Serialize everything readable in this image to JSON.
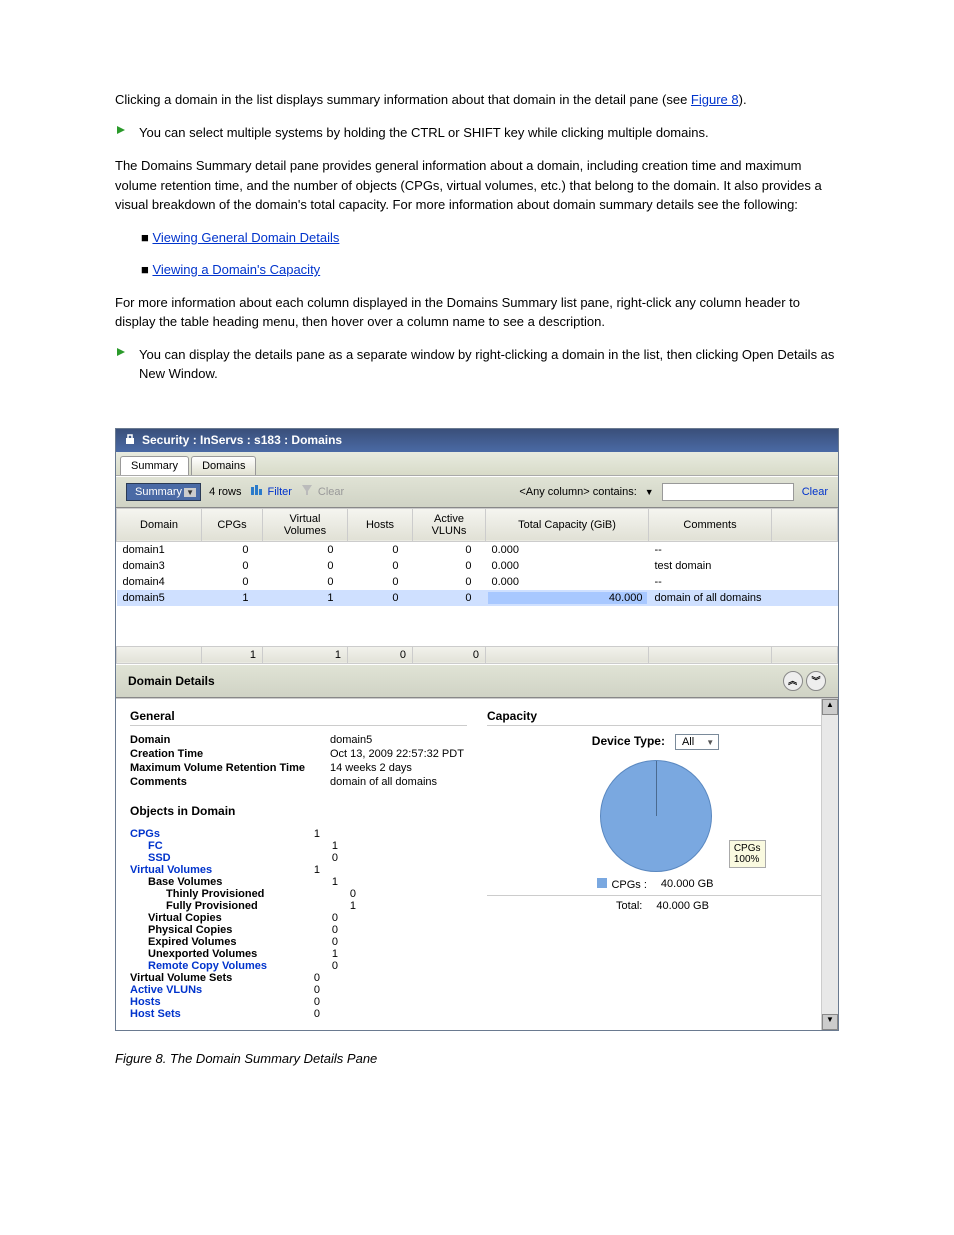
{
  "doc": {
    "text1": "Clicking a domain in the list displays summary information about that domain in the detail pane (see ",
    "link1": "Figure 8",
    "text1b": ").",
    "tip1": "You can select multiple systems by holding the CTRL or SHIFT key while clicking multiple domains.",
    "text2": "The Domains Summary detail pane provides general information about a domain, including creation time and maximum volume retention time, and the number of objects (CPGs, virtual volumes, etc.) that belong to the domain. It also provides a visual breakdown of the domain's total capacity. For more information about domain summary details see the following:",
    "bullet1": "Viewing General Domain Details",
    "bullet2": "Viewing a Domain's Capacity",
    "text3": "For more information about each column displayed in the Domains Summary list pane, right-click any column header to display the table heading menu, then hover over a column name to see a description.",
    "tip2": "You can display the details pane as a separate window by right-clicking a domain in the list, then clicking Open Details as New Window.",
    "figure": "Figure 8. The Domain Summary Details Pane"
  },
  "window": {
    "title": "Security : InServs : s183 : Domains",
    "tabs": {
      "summary": "Summary",
      "domains": "Domains"
    },
    "toolbar": {
      "summary": "Summary",
      "rows": "4 rows",
      "filter": "Filter",
      "clear_filter": "Clear",
      "search_label": "<Any column> contains:",
      "clear": "Clear"
    },
    "columns": [
      "Domain",
      "CPGs",
      "Virtual Volumes",
      "Hosts",
      "Active VLUNs",
      "Total Capacity (GiB)",
      "Comments"
    ],
    "rows": [
      {
        "domain": "domain1",
        "cpgs": 0,
        "vv": 0,
        "hosts": 0,
        "vluns": 0,
        "cap": "0.000",
        "comments": "--"
      },
      {
        "domain": "domain3",
        "cpgs": 0,
        "vv": 0,
        "hosts": 0,
        "vluns": 0,
        "cap": "0.000",
        "comments": "test domain"
      },
      {
        "domain": "domain4",
        "cpgs": 0,
        "vv": 0,
        "hosts": 0,
        "vluns": 0,
        "cap": "0.000",
        "comments": "--"
      },
      {
        "domain": "domain5",
        "cpgs": 1,
        "vv": 1,
        "hosts": 0,
        "vluns": 0,
        "cap": "40.000",
        "comments": "domain of all domains",
        "selected": true
      }
    ],
    "totals": {
      "cpgs": 1,
      "vv": 1,
      "hosts": 0,
      "vluns": 0
    }
  },
  "details": {
    "header": "Domain Details",
    "general": "General",
    "kv": {
      "domain_k": "Domain",
      "domain_v": "domain5",
      "ctime_k": "Creation Time",
      "ctime_v": "Oct 13, 2009 22:57:32 PDT",
      "ret_k": "Maximum Volume Retention Time",
      "ret_v": "14 weeks 2 days",
      "com_k": "Comments",
      "com_v": "domain of all domains"
    },
    "objects_title": "Objects in Domain",
    "objects": [
      {
        "label": "CPGs",
        "val": 1,
        "cls": "",
        "link": true
      },
      {
        "label": "FC",
        "val": 1,
        "cls": "sub1",
        "link": true
      },
      {
        "label": "SSD",
        "val": 0,
        "cls": "sub1",
        "link": true
      },
      {
        "label": "Virtual Volumes",
        "val": 1,
        "cls": "",
        "link": true
      },
      {
        "label": "Base Volumes",
        "val": 1,
        "cls": "sub1",
        "link": false,
        "bold": true
      },
      {
        "label": "Thinly Provisioned",
        "val": 0,
        "cls": "sub2",
        "link": false,
        "bold": true
      },
      {
        "label": "Fully Provisioned",
        "val": 1,
        "cls": "sub2",
        "link": false,
        "bold": true
      },
      {
        "label": "Virtual Copies",
        "val": 0,
        "cls": "sub1",
        "link": false,
        "bold": true
      },
      {
        "label": "Physical Copies",
        "val": 0,
        "cls": "sub1",
        "link": false,
        "bold": true
      },
      {
        "label": "Expired Volumes",
        "val": 0,
        "cls": "sub1",
        "link": false,
        "bold": true
      },
      {
        "label": "Unexported Volumes",
        "val": 1,
        "cls": "sub1",
        "link": false,
        "bold": true
      },
      {
        "label": "Remote Copy Volumes",
        "val": 0,
        "cls": "sub1",
        "link": true
      },
      {
        "label": "Virtual Volume Sets",
        "val": 0,
        "cls": "",
        "link": false,
        "bold": true
      },
      {
        "label": "Active VLUNs",
        "val": 0,
        "cls": "",
        "link": true
      },
      {
        "label": "Hosts",
        "val": 0,
        "cls": "",
        "link": true
      },
      {
        "label": "Host Sets",
        "val": 0,
        "cls": "",
        "link": true
      }
    ],
    "capacity": {
      "title": "Capacity",
      "device_type_label": "Device Type:",
      "device_type_value": "All",
      "pie_label": "CPGs\n100%",
      "legend_cpgs": "CPGs :",
      "legend_cpgs_val": "40.000 GB",
      "legend_total": "Total:",
      "legend_total_val": "40.000 GB"
    }
  },
  "chart_data": {
    "type": "pie",
    "title": "Capacity",
    "series": [
      {
        "name": "CPGs",
        "value": 40.0,
        "unit": "GB",
        "percent": 100
      }
    ],
    "total": {
      "value": 40.0,
      "unit": "GB"
    }
  }
}
